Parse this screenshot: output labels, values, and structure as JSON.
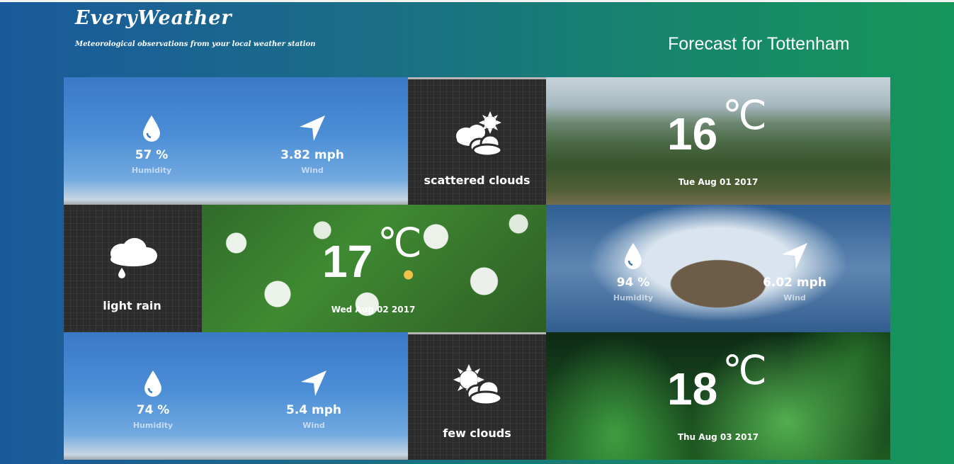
{
  "header": {
    "brand": "EveryWeather",
    "tagline": "Meteorological observations from your local weather station",
    "forecast_title": "Forecast for Tottenham"
  },
  "days": [
    {
      "humidity": "57 %",
      "humidity_label": "Humidity",
      "wind": "3.82 mph",
      "wind_label": "Wind",
      "condition": "scattered clouds",
      "condition_icon": "scattered-clouds-icon",
      "temp_value": "16",
      "temp_unit": "℃",
      "date": "Tue Aug 01 2017"
    },
    {
      "humidity": "94 %",
      "humidity_label": "Humidity",
      "wind": "6.02 mph",
      "wind_label": "Wind",
      "condition": "light rain",
      "condition_icon": "light-rain-icon",
      "temp_value": "17",
      "temp_unit": "℃",
      "date": "Wed Aug 02 2017"
    },
    {
      "humidity": "74 %",
      "humidity_label": "Humidity",
      "wind": "5.4 mph",
      "wind_label": "Wind",
      "condition": "few clouds",
      "condition_icon": "few-clouds-icon",
      "temp_value": "18",
      "temp_unit": "℃",
      "date": "Thu Aug 03 2017"
    }
  ]
}
